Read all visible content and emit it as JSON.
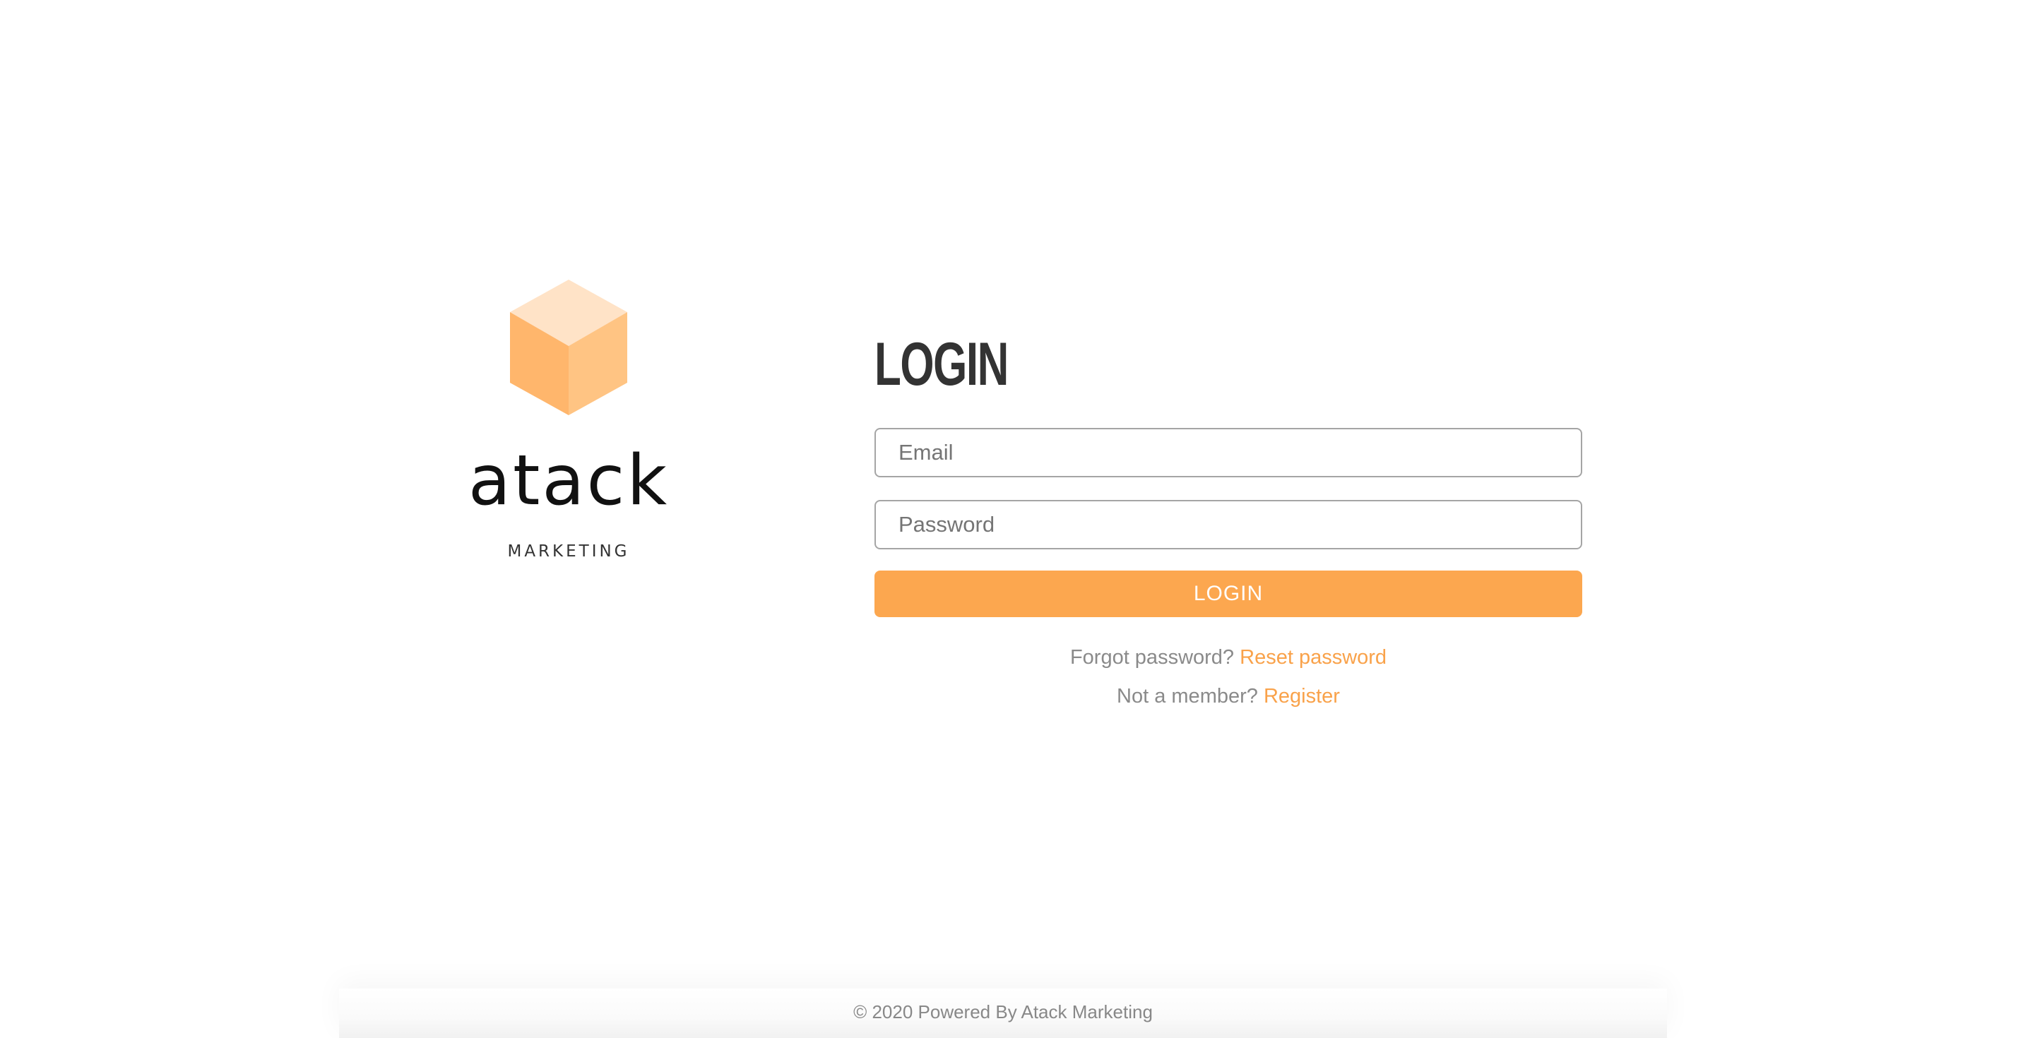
{
  "brand": {
    "name": "atack",
    "tagline": "MARKETING",
    "logo_icon": "cube-icon",
    "logo_colors": {
      "top": "#ffe3c7",
      "left": "#ffb66c",
      "right": "#ffc483"
    }
  },
  "login": {
    "title": "LOGIN",
    "email_placeholder": "Email",
    "password_placeholder": "Password",
    "button_label": "LOGIN"
  },
  "links": {
    "forgot_text": "Forgot password?",
    "reset_link": "Reset password",
    "member_text": "Not a member?",
    "register_link": "Register"
  },
  "footer": {
    "text": "© 2020 Powered By Atack Marketing"
  },
  "colors": {
    "accent": "#fca74f",
    "link": "#f9a24a",
    "title": "#333333",
    "muted_text": "#8a8a8a"
  }
}
